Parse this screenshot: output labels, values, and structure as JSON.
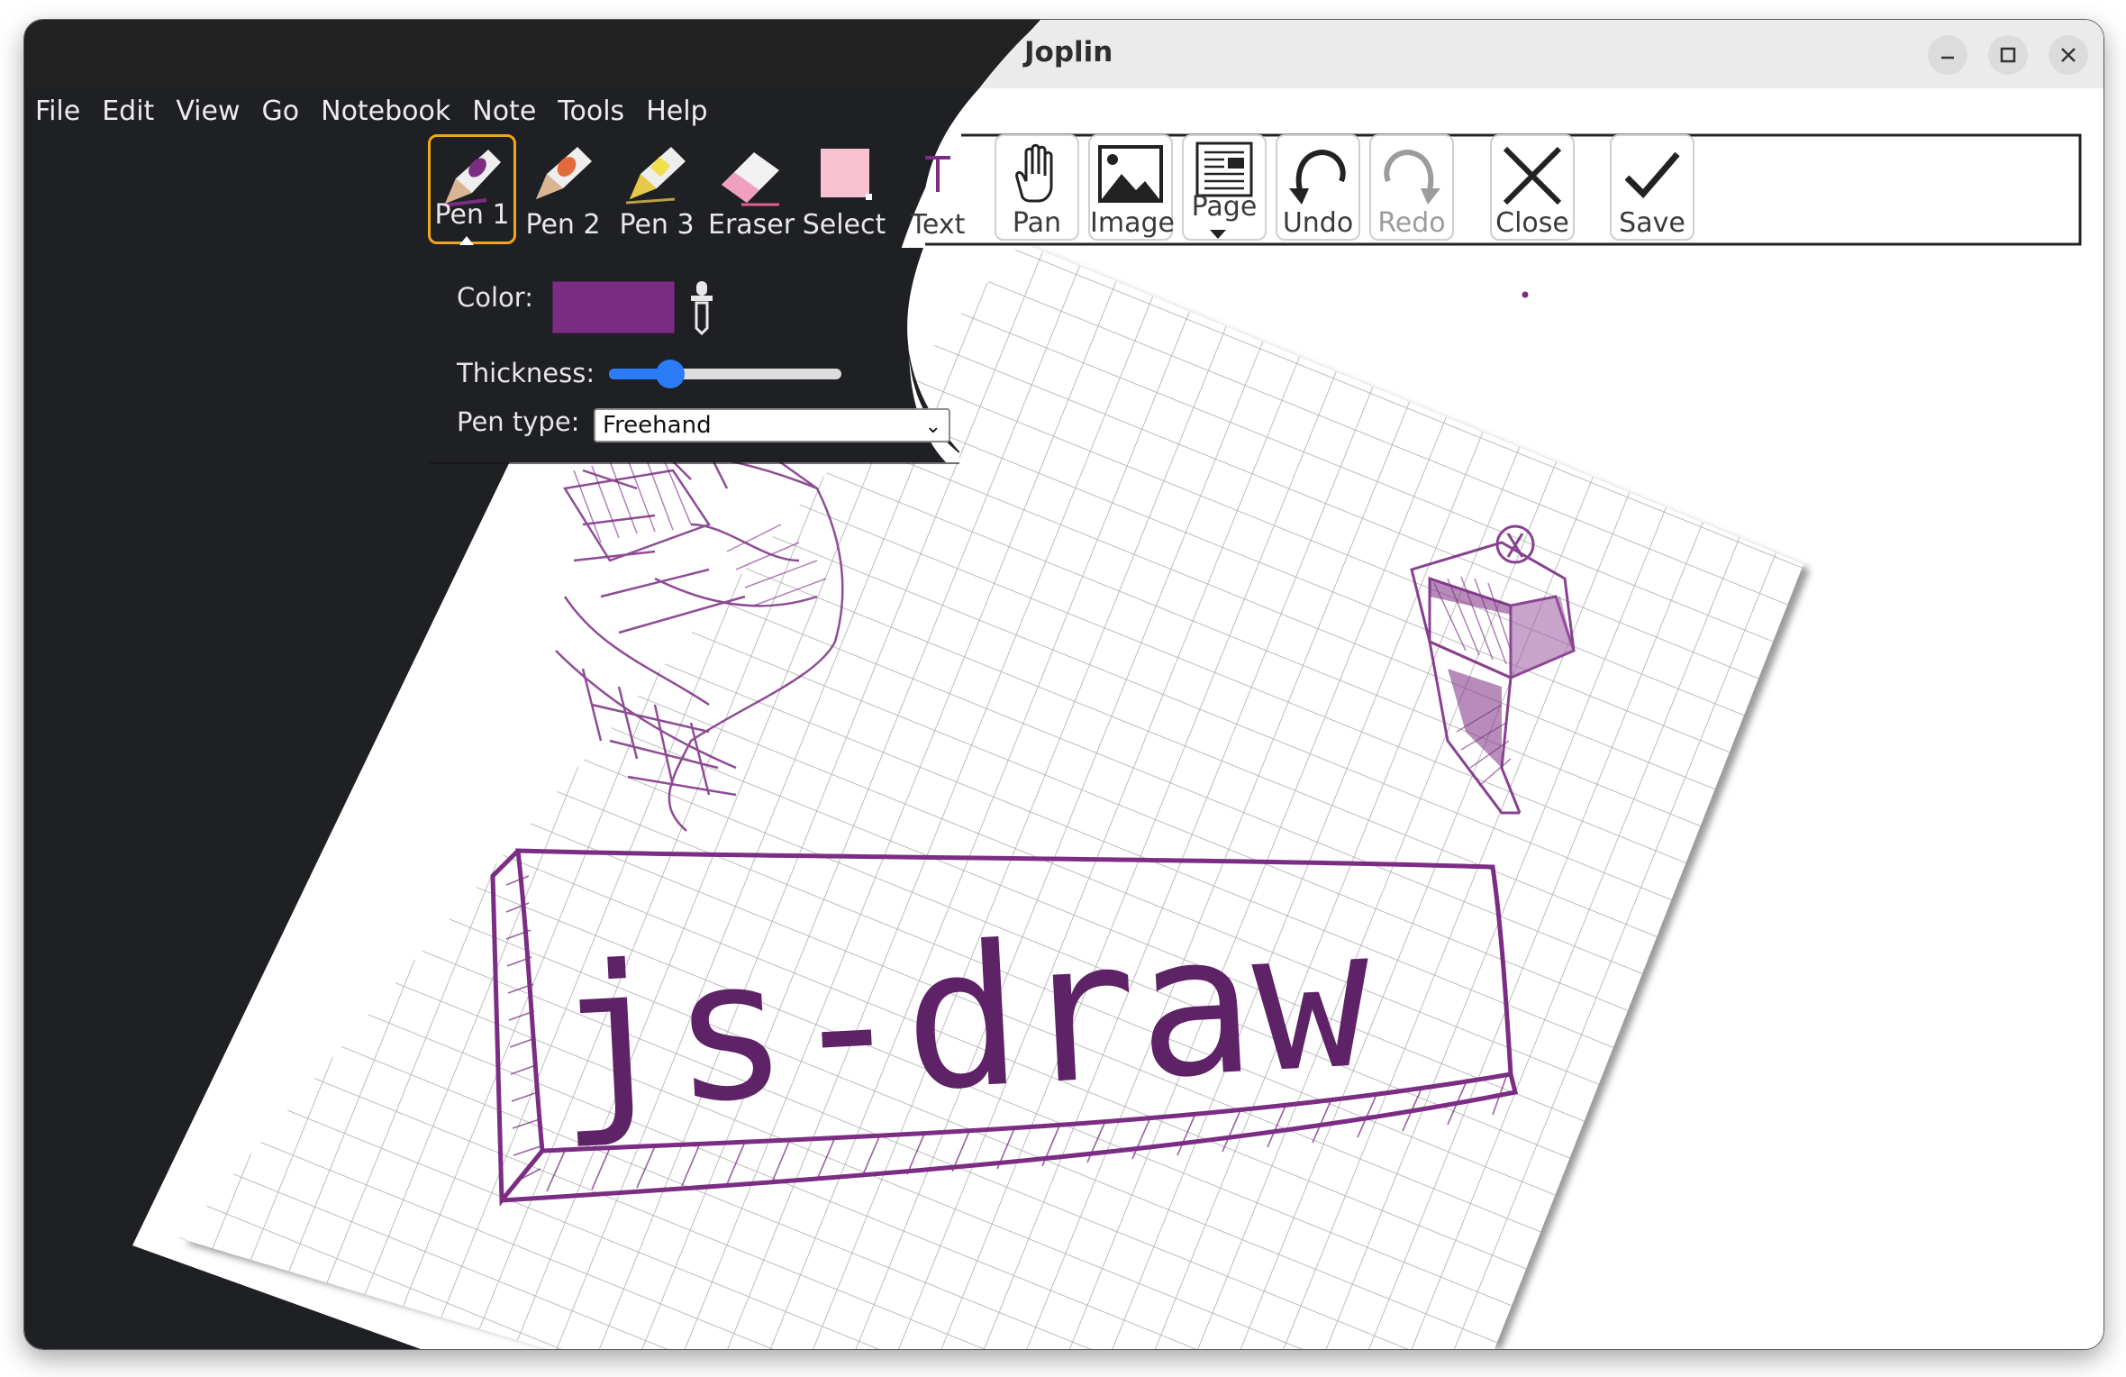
{
  "window": {
    "title": "Joplin",
    "controls": [
      "minimize-icon",
      "maximize-icon",
      "close-icon"
    ]
  },
  "menu": [
    "File",
    "Edit",
    "View",
    "Go",
    "Notebook",
    "Note",
    "Tools",
    "Help"
  ],
  "toolbar": {
    "pen1": "Pen 1",
    "pen2": "Pen 2",
    "pen3": "Pen 3",
    "eraser": "Eraser",
    "select": "Select",
    "text": "Text",
    "pan": "Pan",
    "image": "Image",
    "page": "Page",
    "undo": "Undo",
    "redo": "Redo",
    "close": "Close",
    "save": "Save"
  },
  "pen_options": {
    "color_label": "Color:",
    "color_value": "#7b2d83",
    "thickness_label": "Thickness:",
    "thickness_fraction": 0.2,
    "pen_type_label": "Pen type:",
    "pen_type_value": "Freehand"
  },
  "drawing": {
    "text": "js-draw"
  },
  "colors": {
    "ink": "#7b2d83",
    "dark_bg": "#1e2023",
    "accent": "#f2a51a",
    "slider": "#2b7cf6"
  }
}
